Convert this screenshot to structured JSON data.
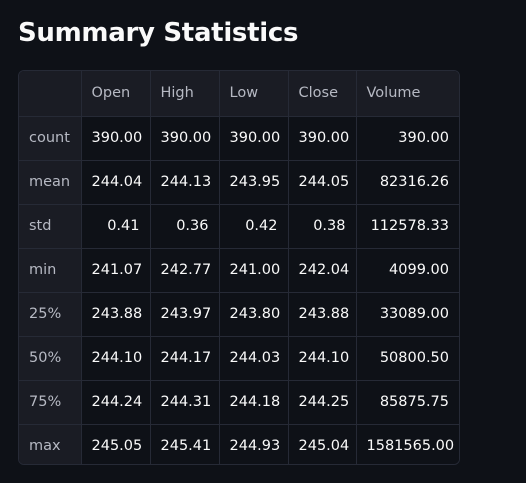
{
  "page": {
    "title": "Summary Statistics"
  },
  "table": {
    "columns": [
      "",
      "Open",
      "High",
      "Low",
      "Close",
      "Volume"
    ],
    "rows": [
      {
        "label": "count",
        "values": [
          "390.00",
          "390.00",
          "390.00",
          "390.00",
          "390.00"
        ]
      },
      {
        "label": "mean",
        "values": [
          "244.04",
          "244.13",
          "243.95",
          "244.05",
          "82316.26"
        ]
      },
      {
        "label": "std",
        "values": [
          "0.41",
          "0.36",
          "0.42",
          "0.38",
          "112578.33"
        ]
      },
      {
        "label": "min",
        "values": [
          "241.07",
          "242.77",
          "241.00",
          "242.04",
          "4099.00"
        ]
      },
      {
        "label": "25%",
        "values": [
          "243.88",
          "243.97",
          "243.80",
          "243.88",
          "33089.00"
        ]
      },
      {
        "label": "50%",
        "values": [
          "244.10",
          "244.17",
          "244.03",
          "244.10",
          "50800.50"
        ]
      },
      {
        "label": "75%",
        "values": [
          "244.24",
          "244.31",
          "244.18",
          "244.25",
          "85875.75"
        ]
      },
      {
        "label": "max",
        "values": [
          "245.05",
          "245.41",
          "244.93",
          "245.04",
          "1581565.00"
        ]
      }
    ]
  }
}
